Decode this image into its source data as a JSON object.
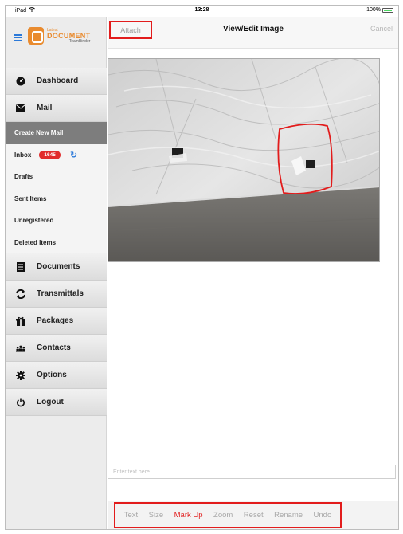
{
  "status": {
    "carrier": "iPad",
    "time": "13:28",
    "battery": "100%"
  },
  "logo": {
    "small": "Latest",
    "main": "DOCUMENT",
    "sub": "TeamBinder"
  },
  "sidebar": {
    "items": [
      {
        "label": "Dashboard"
      },
      {
        "label": "Mail"
      }
    ],
    "mail_items": [
      {
        "label": "Create New Mail"
      },
      {
        "label": "Inbox",
        "badge": "1645"
      },
      {
        "label": "Drafts"
      },
      {
        "label": "Sent Items"
      },
      {
        "label": "Unregistered"
      },
      {
        "label": "Deleted Items"
      }
    ],
    "bottom_items": [
      {
        "label": "Documents"
      },
      {
        "label": "Transmittals"
      },
      {
        "label": "Packages"
      },
      {
        "label": "Contacts"
      },
      {
        "label": "Options"
      },
      {
        "label": "Logout"
      }
    ]
  },
  "topbar": {
    "attach": "Attach",
    "title": "View/Edit Image",
    "cancel": "Cancel"
  },
  "note": {
    "placeholder": "Enter text here"
  },
  "toolbar": {
    "tools": [
      "Text",
      "Size",
      "Mark Up",
      "Zoom",
      "Reset",
      "Rename",
      "Undo"
    ],
    "active": "Mark Up"
  },
  "colors": {
    "accent_blue": "#2b79d9",
    "markup_red": "#e21c1c",
    "badge_red": "#e12b2b",
    "logo_orange": "#e98b2f"
  }
}
